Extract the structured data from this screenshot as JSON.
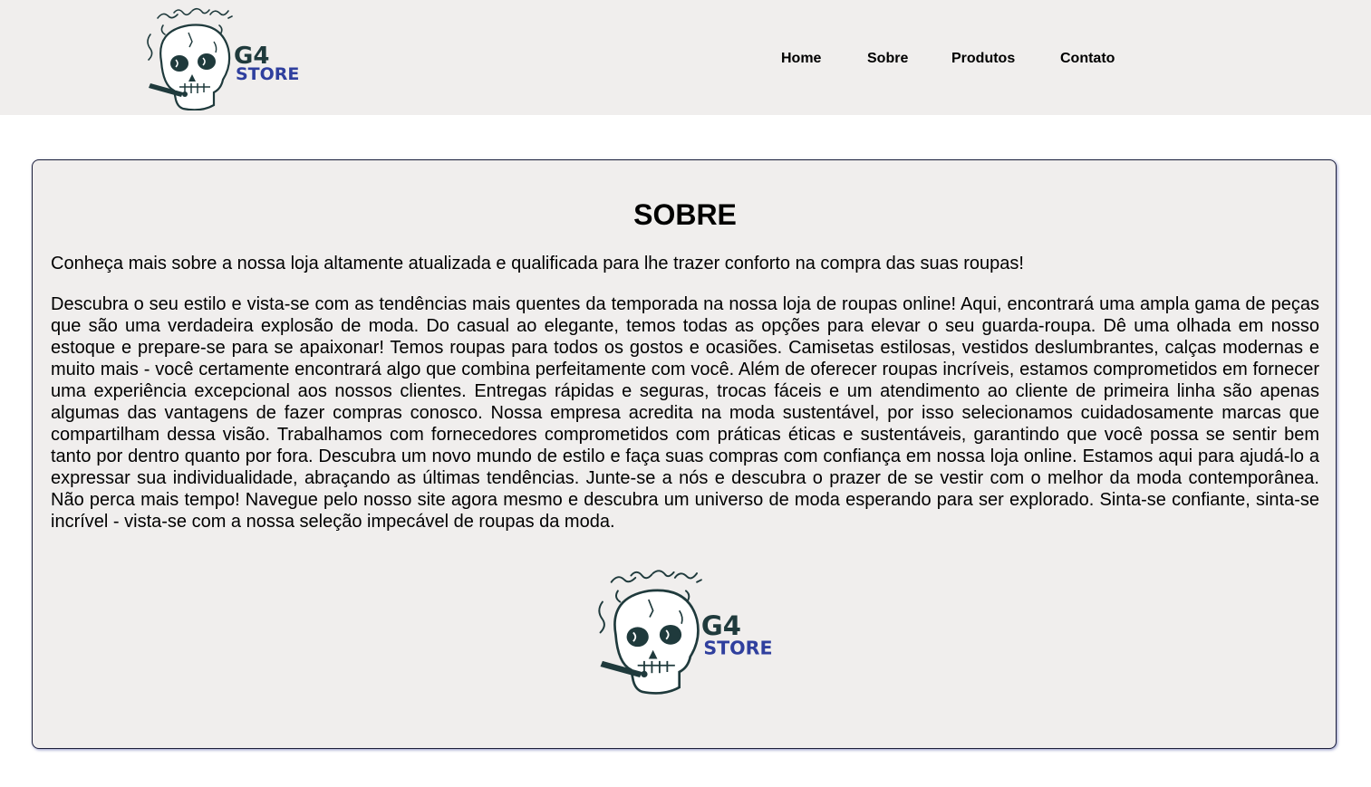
{
  "brand": {
    "line1": "G4",
    "line2": "STORE",
    "color_dark": "#1f3a3c",
    "color_accent": "#2f3f9e"
  },
  "nav": {
    "items": [
      {
        "label": "Home"
      },
      {
        "label": "Sobre"
      },
      {
        "label": "Produtos"
      },
      {
        "label": "Contato"
      }
    ]
  },
  "about": {
    "title": "SOBRE",
    "intro": "Conheça mais sobre a nossa loja altamente atualizada e qualificada para lhe trazer conforto na compra das suas roupas!",
    "body": "Descubra o seu estilo e vista-se com as tendências mais quentes da temporada na nossa loja de roupas online! Aqui, encontrará uma ampla gama de peças que são uma verdadeira explosão de moda. Do casual ao elegante, temos todas as opções para elevar o seu guarda-roupa. Dê uma olhada em nosso estoque e prepare-se para se apaixonar! Temos roupas para todos os gostos e ocasiões. Camisetas estilosas, vestidos deslumbrantes, calças modernas e muito mais - você certamente encontrará algo que combina perfeitamente com você. Além de oferecer roupas incríveis, estamos comprometidos em fornecer uma experiência excepcional aos nossos clientes. Entregas rápidas e seguras, trocas fáceis e um atendimento ao cliente de primeira linha são apenas algumas das vantagens de fazer compras conosco. Nossa empresa acredita na moda sustentável, por isso selecionamos cuidadosamente marcas que compartilham dessa visão. Trabalhamos com fornecedores comprometidos com práticas éticas e sustentáveis, garantindo que você possa se sentir bem tanto por dentro quanto por fora. Descubra um novo mundo de estilo e faça suas compras com confiança em nossa loja online. Estamos aqui para ajudá-lo a expressar sua individualidade, abraçando as últimas tendências. Junte-se a nós e descubra o prazer de se vestir com o melhor da moda contemporânea. Não perca mais tempo! Navegue pelo nosso site agora mesmo e descubra um universo de moda esperando para ser explorado. Sinta-se confiante, sinta-se incrível - vista-se com a nossa seleção impecável de roupas da moda."
  }
}
